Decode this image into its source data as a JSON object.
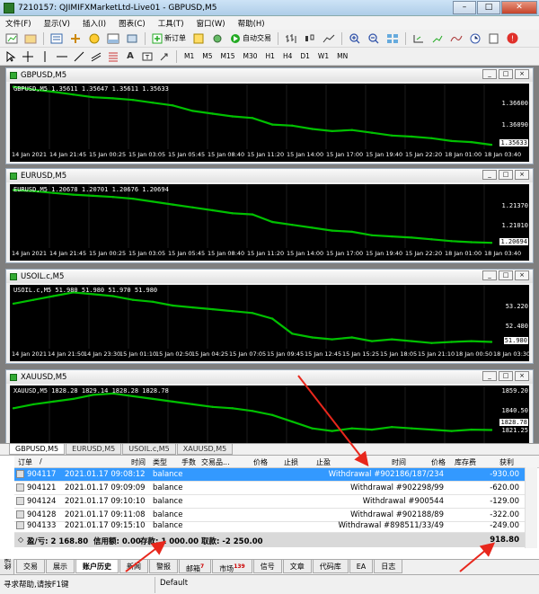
{
  "window": {
    "title": "7210157: QJIMIFXMarketLtd-Live01 - GBPUSD,M5",
    "minimize": "–",
    "maximize": "□",
    "close": "✕"
  },
  "menu": [
    "文件(F)",
    "显示(V)",
    "插入(I)",
    "图表(C)",
    "工具(T)",
    "窗口(W)",
    "帮助(H)"
  ],
  "toolbar": {
    "new_order": "新订单",
    "auto_trading": "自动交易",
    "notification_badge": "1"
  },
  "timeframes": [
    "M1",
    "M5",
    "M15",
    "M30",
    "H1",
    "H4",
    "D1",
    "W1",
    "MN"
  ],
  "charts": [
    {
      "title": "GBPUSD,M5",
      "ohlc_label": "GBPUSD,M5  1.35611 1.35647 1.35611 1.35633",
      "price_ticks": [
        "1.36600",
        "1.36090"
      ],
      "current_price": "1.35633",
      "time_labels": [
        "14 Jan 2021",
        "14 Jan 21:45",
        "15 Jan 00:25",
        "15 Jan 03:05",
        "15 Jan 05:45",
        "15 Jan 08:40",
        "15 Jan 11:20",
        "15 Jan 14:00",
        "15 Jan 17:00",
        "15 Jan 19:40",
        "15 Jan 22:20",
        "18 Jan 01:00",
        "18 Jan 03:40"
      ],
      "chart_data": {
        "type": "line",
        "y": [
          1.3669,
          1.3664,
          1.366,
          1.3655,
          1.365,
          1.3648,
          1.3645,
          1.364,
          1.3635,
          1.3625,
          1.362,
          1.3615,
          1.3612,
          1.36,
          1.3598,
          1.3592,
          1.3588,
          1.359,
          1.3585,
          1.358,
          1.3578,
          1.3575,
          1.357,
          1.3568,
          1.3563
        ],
        "ylim": [
          1.3555,
          1.3675
        ]
      }
    },
    {
      "title": "EURUSD,M5",
      "ohlc_label": "EURUSD,M5  1.20678 1.20701 1.20676 1.20694",
      "price_ticks": [
        "1.21370",
        "1.21010"
      ],
      "current_price": "1.20694",
      "time_labels": [
        "14 Jan 2021",
        "14 Jan 21:45",
        "15 Jan 00:25",
        "15 Jan 03:05",
        "15 Jan 05:45",
        "15 Jan 08:40",
        "15 Jan 11:20",
        "15 Jan 14:00",
        "15 Jan 17:00",
        "15 Jan 19:40",
        "15 Jan 22:20",
        "18 Jan 01:00",
        "18 Jan 03:40"
      ],
      "chart_data": {
        "type": "line",
        "y": [
          1.216,
          1.2158,
          1.2155,
          1.2152,
          1.215,
          1.2148,
          1.2145,
          1.214,
          1.2135,
          1.213,
          1.2125,
          1.212,
          1.2118,
          1.2105,
          1.21,
          1.2095,
          1.209,
          1.2088,
          1.2082,
          1.208,
          1.2078,
          1.2075,
          1.2072,
          1.207,
          1.2069
        ],
        "ylim": [
          1.206,
          1.217
        ]
      }
    },
    {
      "title": "USOIL.c,M5",
      "ohlc_label": "USOIL.c,M5  51.980 51.980 51.970 51.980",
      "price_ticks": [
        "53.220",
        "52.480"
      ],
      "current_price": "51.980",
      "time_labels": [
        "14 Jan 2021",
        "14 Jan 21:50",
        "14 Jan 23:30",
        "15 Jan 01:10",
        "15 Jan 02:50",
        "15 Jan 04:25",
        "15 Jan 07:05",
        "15 Jan 09:45",
        "15 Jan 12:45",
        "15 Jan 15:25",
        "15 Jan 18:05",
        "15 Jan 21:10",
        "18 Jan 00:50",
        "18 Jan 03:30"
      ],
      "chart_data": {
        "type": "line",
        "y": [
          53.0,
          53.1,
          53.2,
          53.3,
          53.25,
          53.2,
          53.1,
          53.05,
          52.95,
          52.9,
          52.85,
          52.8,
          52.75,
          52.6,
          52.2,
          52.1,
          52.05,
          52.1,
          52.0,
          52.05,
          52.0,
          51.95,
          51.98,
          52.0,
          51.98
        ],
        "ylim": [
          51.8,
          53.5
        ]
      }
    },
    {
      "title": "XAUUSD,M5",
      "ohlc_label": "XAUUSD,M5  1828.28 1829.14 1828.28 1828.78",
      "price_ticks": [
        "1859.20",
        "1840.50",
        "1821.25"
      ],
      "current_price": "1828.78",
      "chart_data": {
        "type": "line",
        "y": [
          1845,
          1848,
          1850,
          1852,
          1855,
          1856,
          1854,
          1852,
          1850,
          1848,
          1846,
          1845,
          1843,
          1840,
          1835,
          1830,
          1828,
          1830,
          1829,
          1831,
          1830,
          1829,
          1828,
          1829,
          1828.78
        ],
        "ylim": [
          1815,
          1862
        ]
      }
    }
  ],
  "chart_tabs": [
    "GBPUSD,M5",
    "EURUSD,M5",
    "USOIL.c,M5",
    "XAUUSD,M5"
  ],
  "terminal": {
    "headers": {
      "order": "订单",
      "sort": "/",
      "time": "时间",
      "type": "类型",
      "size": "手数",
      "symbol": "交易品...",
      "price": "价格",
      "sl": "止损",
      "tp": "止盈",
      "ctime": "时间",
      "cprice": "价格",
      "swap": "库存费",
      "profit": "获利"
    },
    "rows": [
      {
        "order": "904117",
        "time": "2021.01.17 09:08:12",
        "type": "balance",
        "comment": "Withdrawal #902186/187/234",
        "profit": "-930.00"
      },
      {
        "order": "904121",
        "time": "2021.01.17 09:09:09",
        "type": "balance",
        "comment": "Withdrawal #902298/99",
        "profit": "-620.00"
      },
      {
        "order": "904124",
        "time": "2021.01.17 09:10:10",
        "type": "balance",
        "comment": "Withdrawal #900544",
        "profit": "-129.00"
      },
      {
        "order": "904128",
        "time": "2021.01.17 09:11:08",
        "type": "balance",
        "comment": "Withdrawal #902188/89",
        "profit": "-322.00"
      },
      {
        "order": "904133",
        "time": "2021.01.17 09:15:10",
        "type": "balance",
        "comment": "Withdrawal #898511/33/49",
        "profit": "-249.00"
      }
    ],
    "summary": {
      "pl": "盈/亏: 2 168.80",
      "credit": "信用额: 0.00",
      "deposit": "存款: 1 000.00",
      "withdrawal": "取款: -2 250.00",
      "total": "918.80"
    }
  },
  "sidebar_label": "终端",
  "bottom_tabs": [
    {
      "label": "交易"
    },
    {
      "label": "展示"
    },
    {
      "label": "账户历史",
      "active": true
    },
    {
      "label": "新闻"
    },
    {
      "label": "警报"
    },
    {
      "label": "邮箱",
      "badge": "7"
    },
    {
      "label": "市场",
      "badge": "139"
    },
    {
      "label": "信号"
    },
    {
      "label": "文章"
    },
    {
      "label": "代码库"
    },
    {
      "label": "EA"
    },
    {
      "label": "日志"
    }
  ],
  "status": {
    "help": "寻求帮助,请按F1键",
    "profile": "Default"
  },
  "colors": {
    "bull": "#00c000",
    "bg": "#000000",
    "selection": "#3399ff",
    "arrow": "#e8271c"
  }
}
